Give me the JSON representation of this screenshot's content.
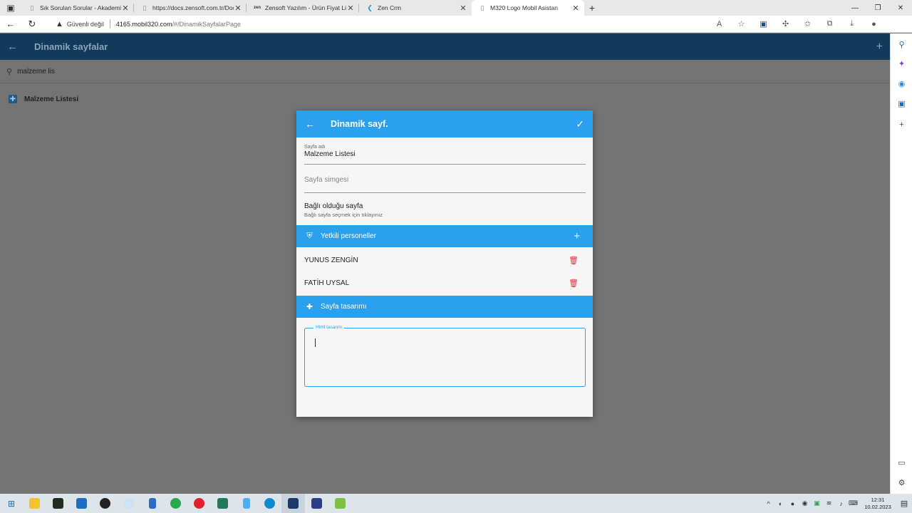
{
  "browser": {
    "tabs": [
      {
        "title": "Sık Sorulan Sorular - AkademiZe",
        "active": false
      },
      {
        "title": "https://docs.zensoft.com.tr/Docs",
        "active": false
      },
      {
        "title": "Zensoft Yazılım - Ürün Fiyat Liste",
        "active": false
      },
      {
        "title": "Zen Crm",
        "active": false
      },
      {
        "title": "M320 Logo Mobil Asistan",
        "active": true
      }
    ],
    "security_label": "Güvenli değil",
    "url_host": "4165.mobil320.com",
    "url_path": "/#/DinamikSayfalarPage"
  },
  "app": {
    "title": "Dinamik sayfalar",
    "search_value": "malzeme lis",
    "list_items": [
      {
        "label": "Malzeme Listesi"
      }
    ]
  },
  "dialog": {
    "title": "Dinamik sayf.",
    "page_name_label": "Sayfa adı",
    "page_name_value": "Malzeme Listesi",
    "page_icon_placeholder": "Sayfa simgesi",
    "linked_page_title": "Bağlı olduğu sayfa",
    "linked_page_hint": "Bağlı sayfa seçmek için tıklayınız",
    "authorized_section": "Yetkili personeller",
    "personnel": [
      {
        "name": "YUNUS ZENGİN"
      },
      {
        "name": "FATİH UYSAL"
      }
    ],
    "design_section": "Sayfa tasarımı",
    "html_label": "Html tasarım",
    "html_value": ""
  },
  "taskbar": {
    "time": "12:31",
    "date": "10.02.2023"
  },
  "colors": {
    "accent": "#2aa0ef",
    "appbar": "#123a5a",
    "delete": "#d9303c"
  }
}
